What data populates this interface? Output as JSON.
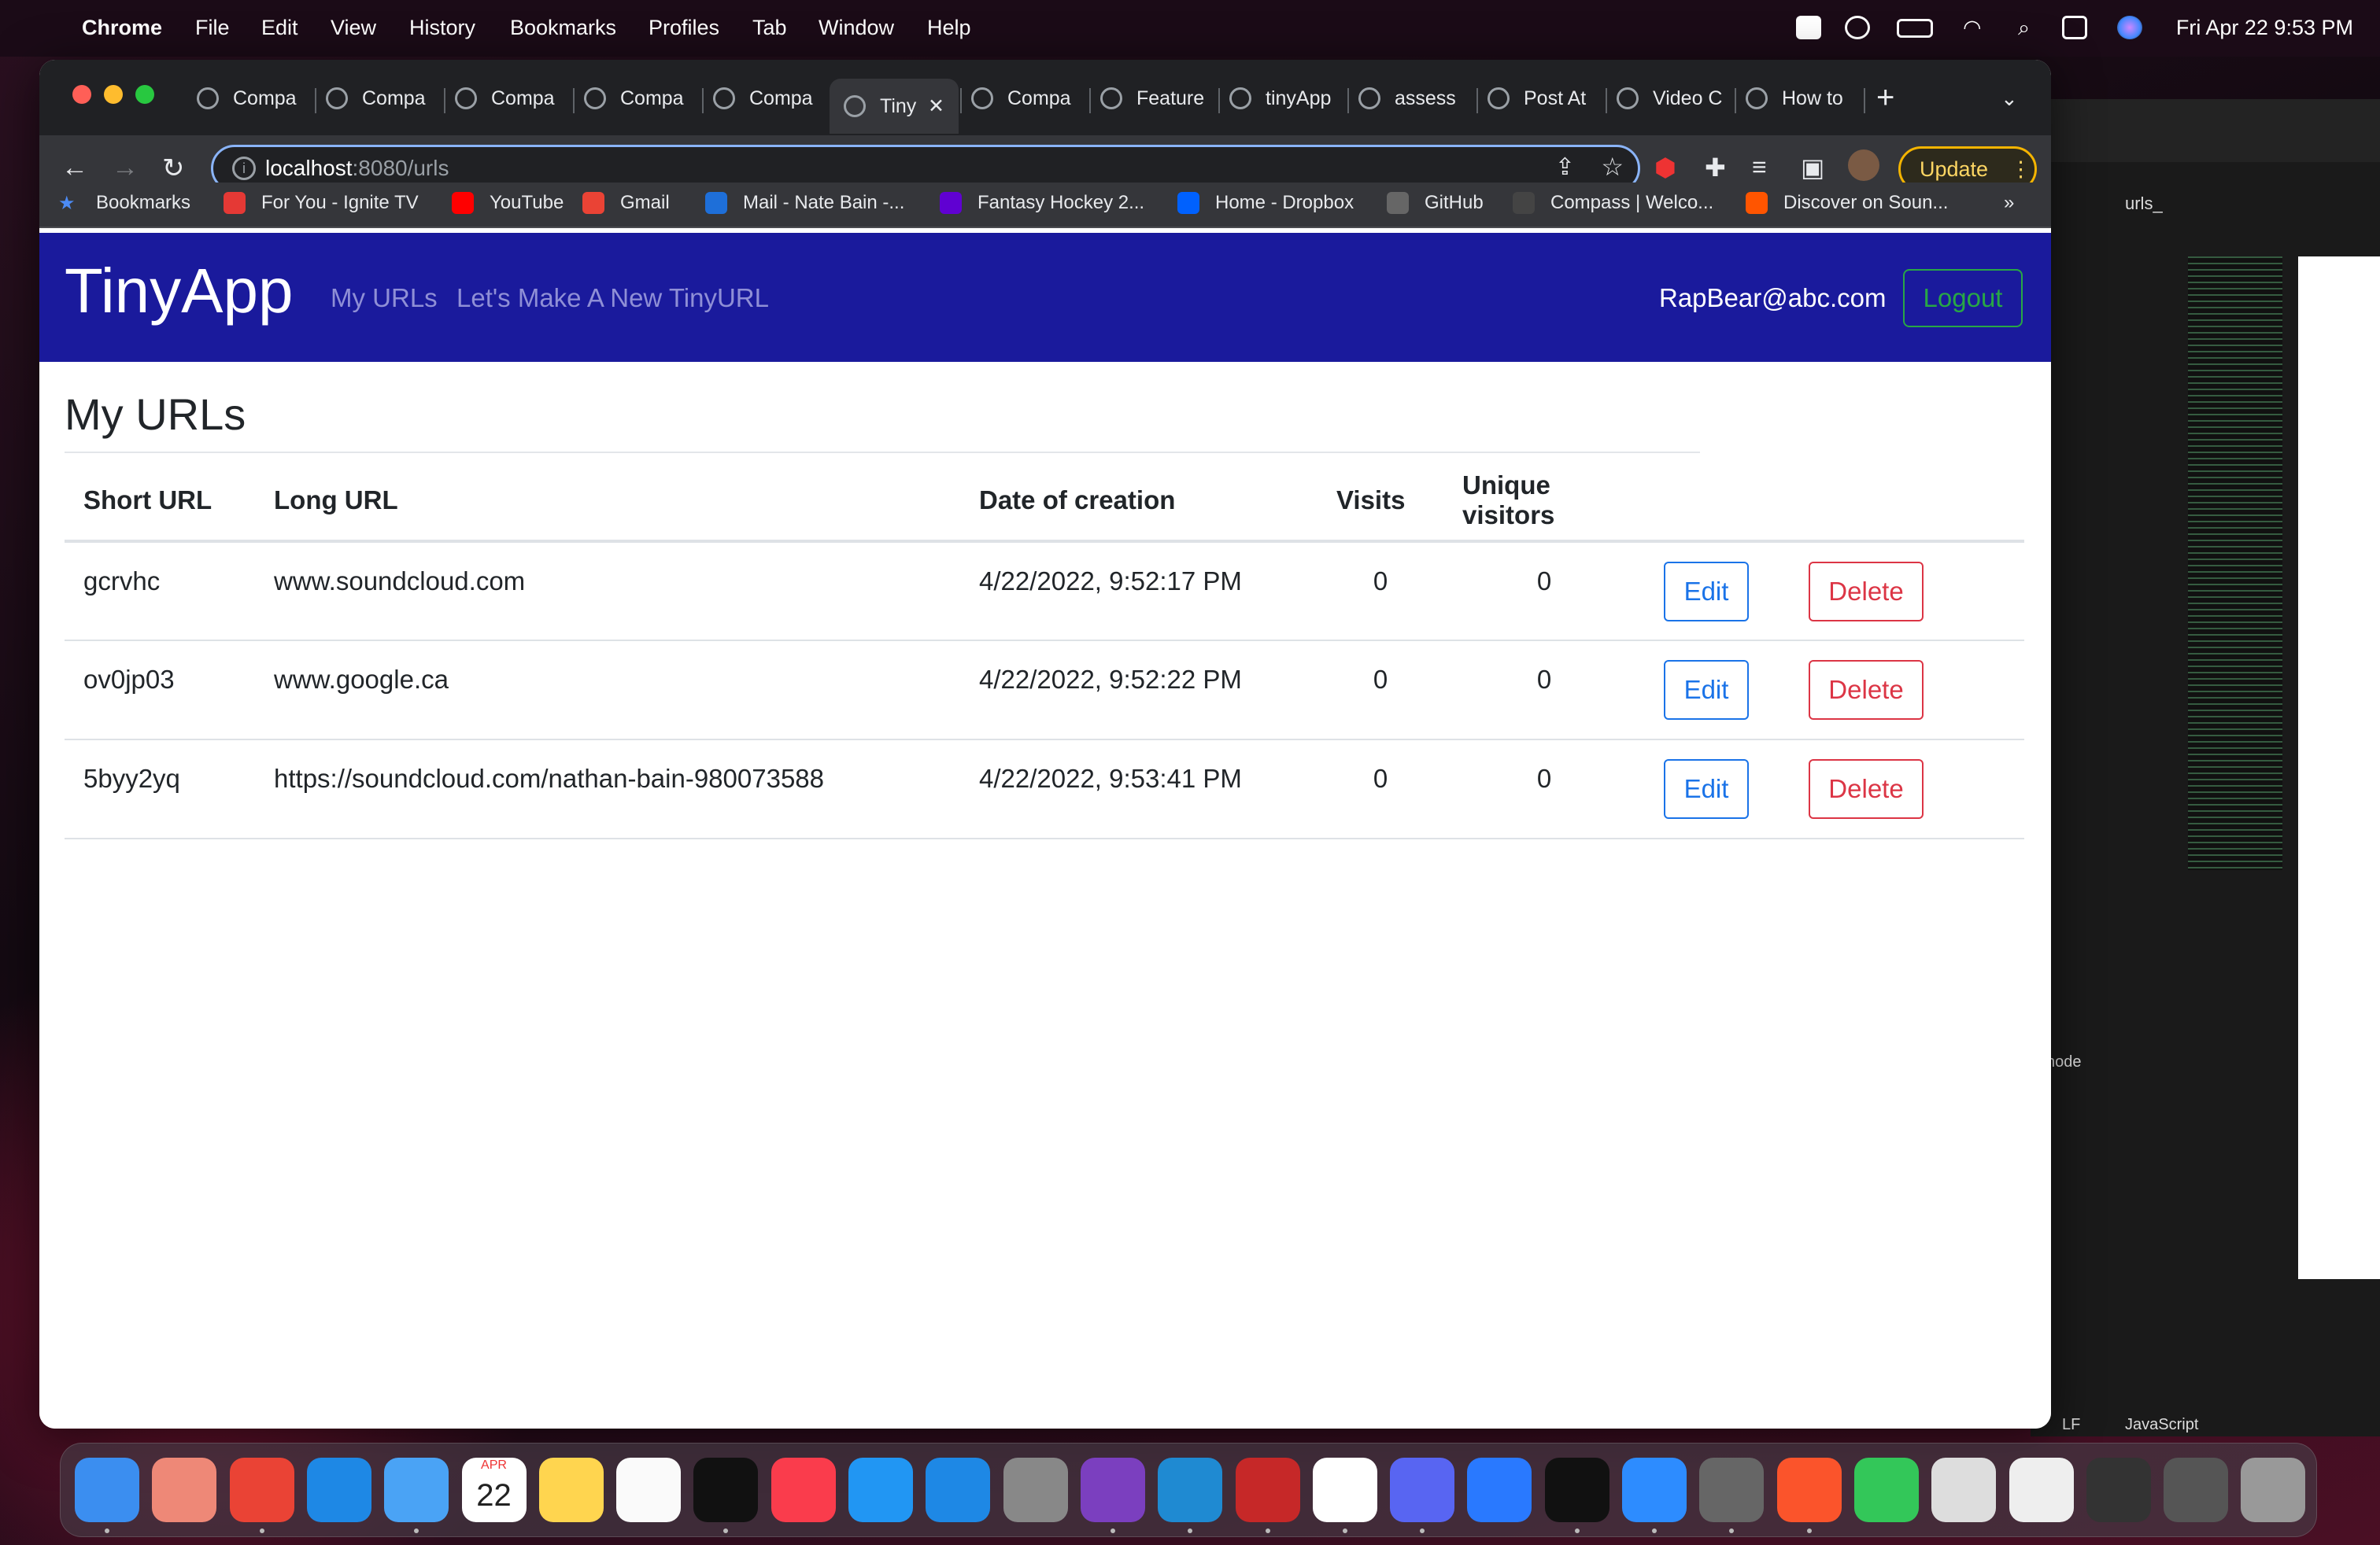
{
  "menubar": {
    "app": "Chrome",
    "items": [
      "File",
      "Edit",
      "View",
      "History",
      "Bookmarks",
      "Profiles",
      "Tab",
      "Window",
      "Help"
    ],
    "clock": "Fri Apr 22  9:53 PM"
  },
  "tabs": [
    "Compa",
    "Compa",
    "Compa",
    "Compa",
    "Compa",
    "Tiny",
    "Compa",
    "Feature",
    "tinyApp",
    "assess",
    "Post At",
    "Video C",
    "How to"
  ],
  "active_tab": 5,
  "address": {
    "host": "localhost",
    "path": ":8080/urls"
  },
  "update_label": "Update",
  "bookmarks": [
    "Bookmarks",
    "For You - Ignite TV",
    "YouTube",
    "Gmail",
    "Mail - Nate Bain -...",
    "Fantasy Hockey 2...",
    "Home - Dropbox",
    "GitHub",
    "Compass | Welco...",
    "Discover on Soun..."
  ],
  "bookmarks_more": "»",
  "app": {
    "brand": "TinyApp",
    "nav": [
      "My URLs",
      "Let's Make A New TinyURL"
    ],
    "user": "RapBear@abc.com",
    "logout": "Logout"
  },
  "page": {
    "title": "My URLs",
    "columns": [
      "Short URL",
      "Long URL",
      "Date of creation",
      "Visits",
      "Unique visitors"
    ],
    "rows": [
      {
        "short": "gcrvhc",
        "long": "www.soundcloud.com",
        "date": "4/22/2022, 9:52:17 PM",
        "visits": "0",
        "unique": "0"
      },
      {
        "short": "ov0jp03",
        "long": "www.google.ca",
        "date": "4/22/2022, 9:52:22 PM",
        "visits": "0",
        "unique": "0"
      },
      {
        "short": "5byy2yq",
        "long": "https://soundcloud.com/nathan-bain-980073588",
        "date": "4/22/2022, 9:53:41 PM",
        "visits": "0",
        "unique": "0"
      }
    ],
    "edit_label": "Edit",
    "delete_label": "Delete"
  },
  "vscode": {
    "tab": "urls_",
    "terminal": "node",
    "lang": "JavaScript",
    "eol": "LF"
  },
  "colors": {
    "navbar": "#1a1a9c",
    "edit": "#1a73e8",
    "delete": "#dc3545",
    "logout": "#28a745"
  }
}
